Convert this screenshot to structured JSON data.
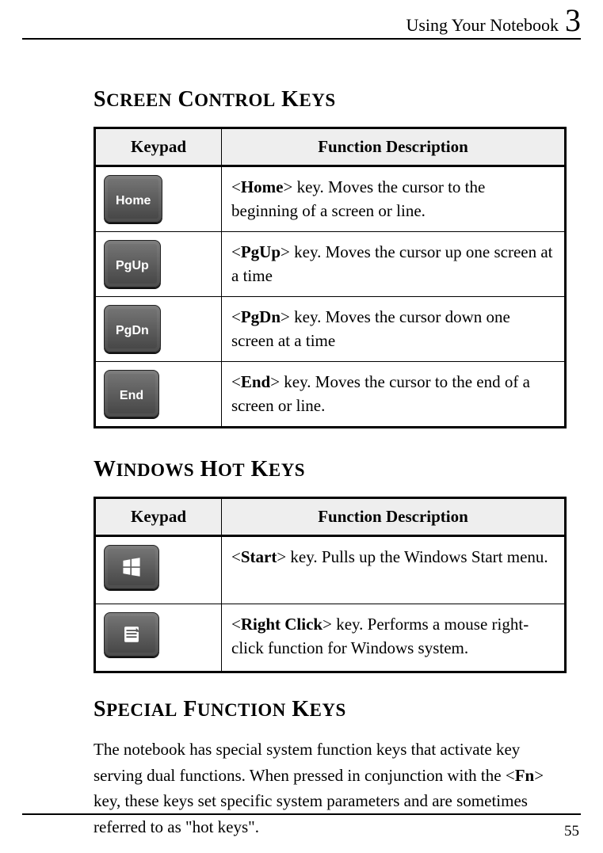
{
  "header": {
    "title": "Using Your Notebook",
    "chapter": "3"
  },
  "sections": {
    "screen": {
      "title": "Screen Control Keys",
      "cols": {
        "k": "Keypad",
        "d": "Function Description"
      },
      "rows": [
        {
          "key": "Home",
          "bold": "Home",
          "pre": "<",
          "post": "> key. Moves the cursor to the beginning of a screen or line."
        },
        {
          "key": "PgUp",
          "bold": "PgUp",
          "pre": "<",
          "post": "> key. Moves the cursor up one screen at a time"
        },
        {
          "key": "PgDn",
          "bold": "PgDn",
          "pre": "<",
          "post": "> key. Moves the cursor down one screen at a time"
        },
        {
          "key": "End",
          "bold": "End",
          "pre": "<",
          "post": "> key. Moves the cursor to the end of a screen or line."
        }
      ]
    },
    "windows": {
      "title": "Windows Hot Keys",
      "cols": {
        "k": "Keypad",
        "d": "Function Description"
      },
      "rows": [
        {
          "icon": "winlogo",
          "bold": "Start",
          "pre": "<",
          "post": "> key. Pulls up the Windows Start menu."
        },
        {
          "icon": "menu",
          "bold": "Right Click",
          "pre": "<",
          "post": "> key. Performs a mouse right-click function for Windows system."
        }
      ]
    },
    "special": {
      "title": "Special Function Keys",
      "para_pre": "The notebook has special system function keys that activate key serving dual functions. When pressed in conjunction with the <",
      "fn": "Fn",
      "para_post": "> key, these keys set specific system parameters and are sometimes referred to as \"hot keys\"."
    }
  },
  "page_number": "55"
}
